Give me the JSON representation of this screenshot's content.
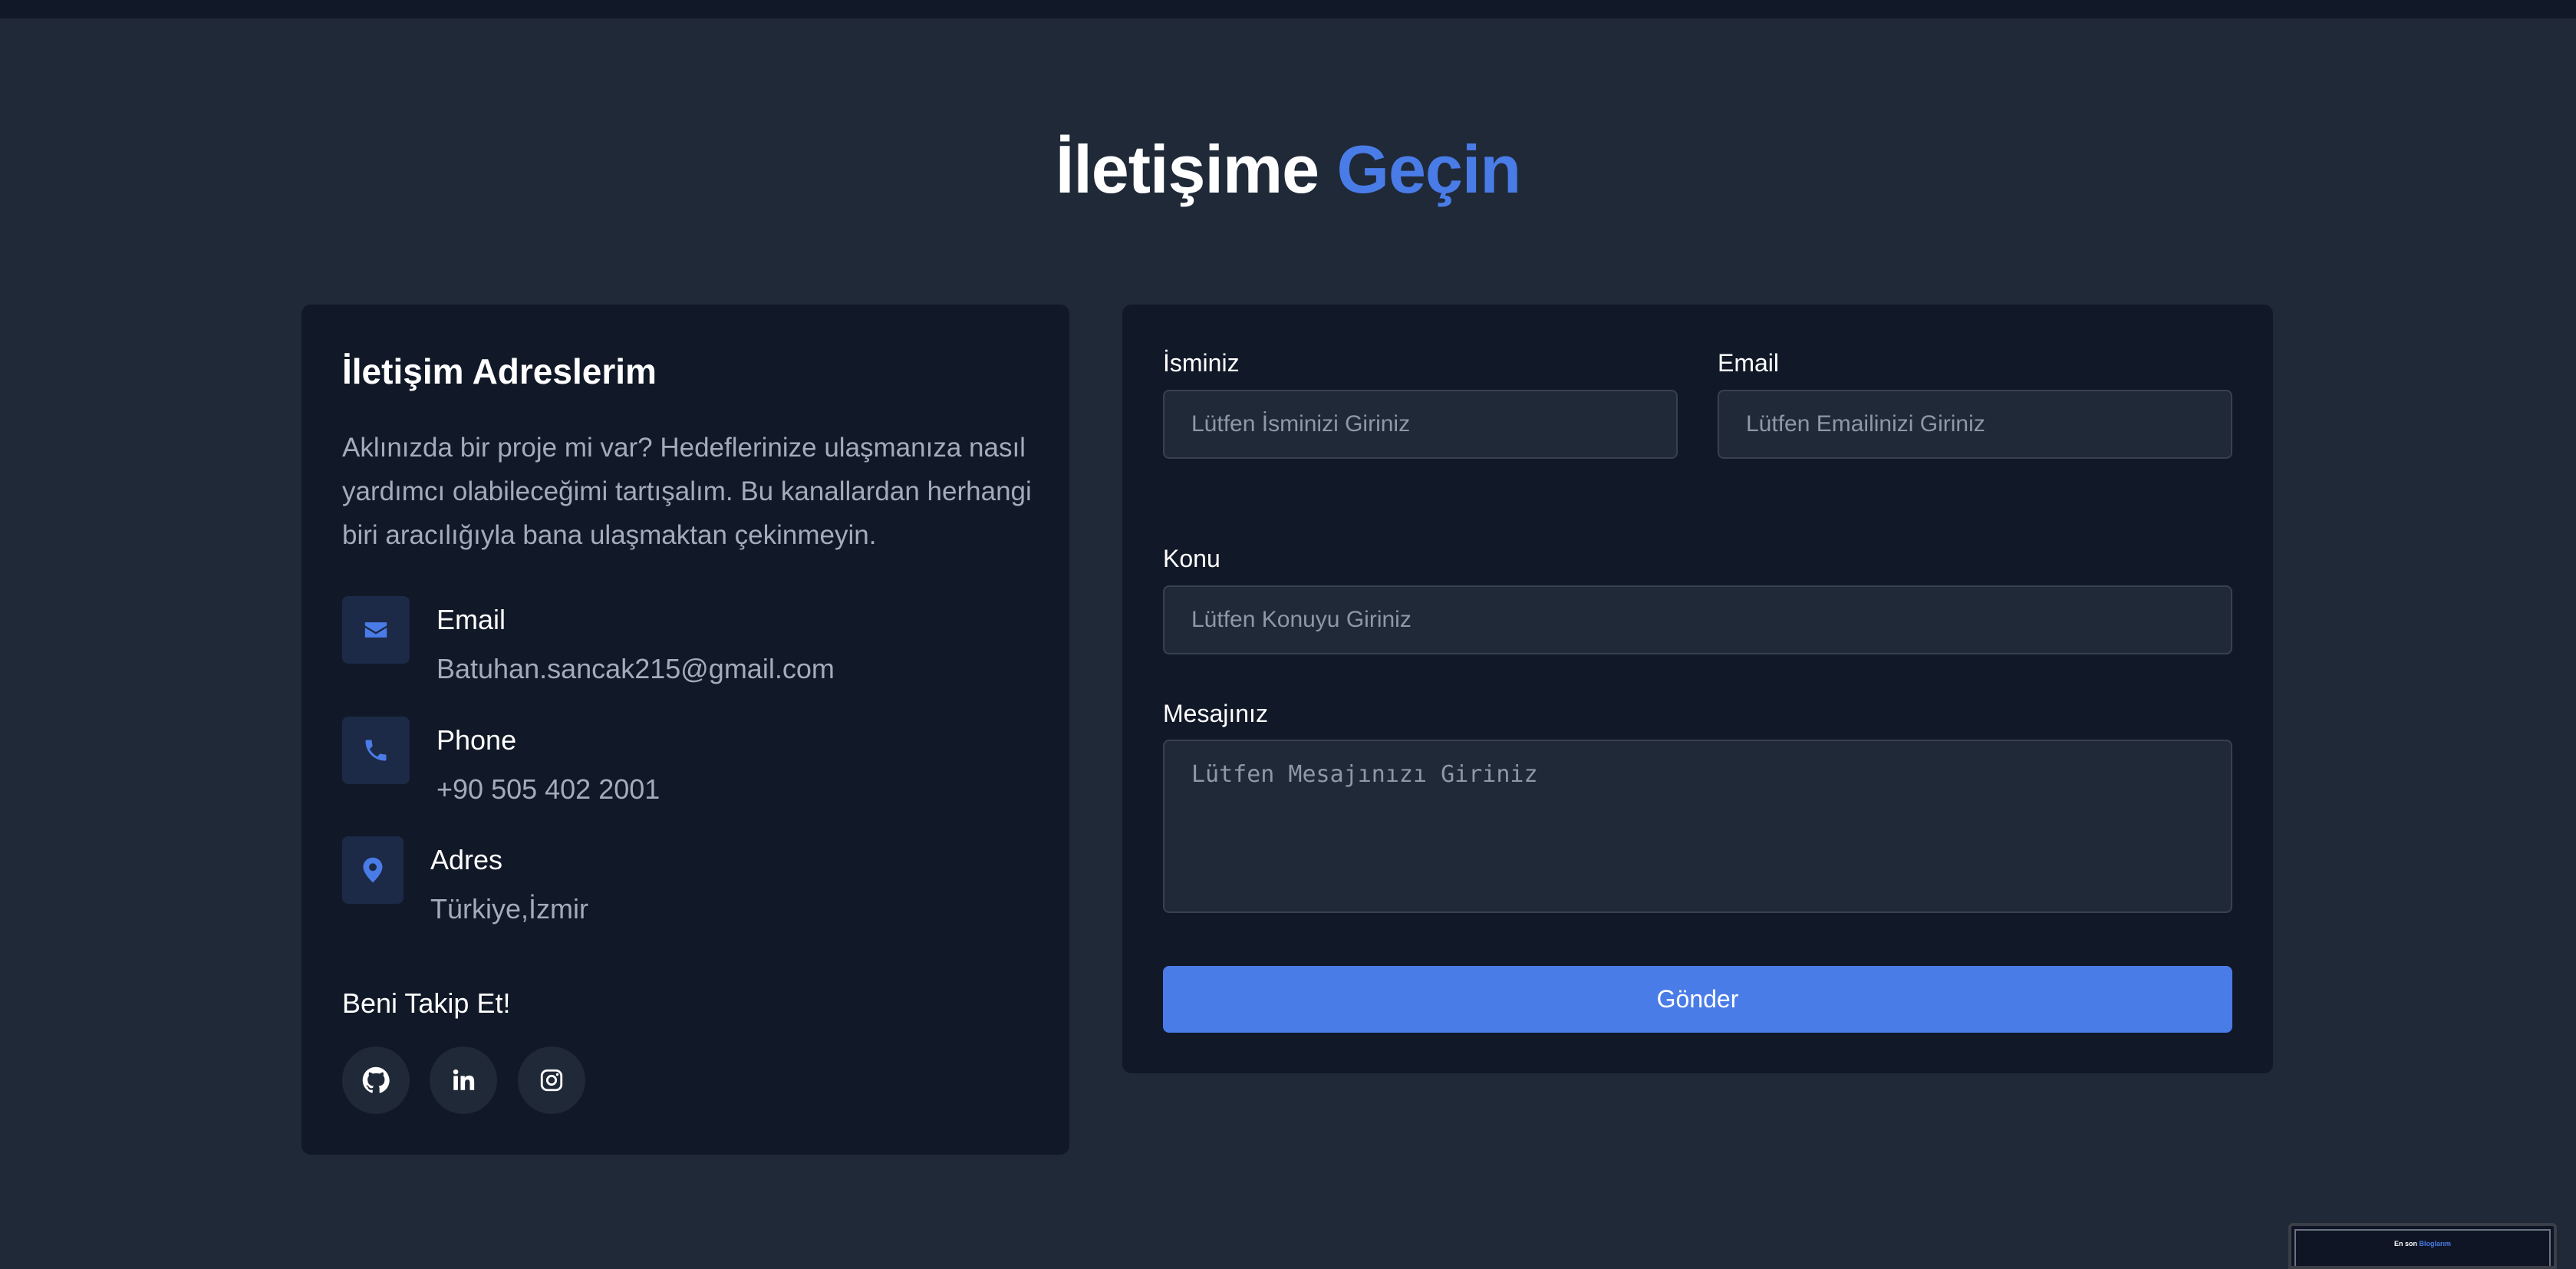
{
  "header": {
    "title_main": "İletişime",
    "title_accent": "Geçin"
  },
  "contact_card": {
    "heading": "İletişim Adreslerim",
    "intro": "Aklınızda bir proje mi var? Hedeflerinize ulaşmanıza nasıl yardımcı olabileceğimi tartışalım. Bu kanallardan herhangi biri aracılığıyla bana ulaşmaktan çekinmeyin.",
    "items": [
      {
        "label": "Email",
        "value": "Batuhan.sancak215@gmail.com",
        "icon": "envelope-icon"
      },
      {
        "label": "Phone",
        "value": "+90 505 402 2001",
        "icon": "phone-icon"
      },
      {
        "label": "Adres",
        "value": "Türkiye,İzmir",
        "icon": "map-pin-icon"
      }
    ],
    "follow_heading": "Beni Takip Et!",
    "socials": [
      "github-icon",
      "linkedin-icon",
      "instagram-icon"
    ]
  },
  "form": {
    "name_label": "İsminiz",
    "name_placeholder": "Lütfen İsminizi Giriniz",
    "email_label": "Email",
    "email_placeholder": "Lütfen Emailinizi Giriniz",
    "subject_label": "Konu",
    "subject_placeholder": "Lütfen Konuyu Giriniz",
    "message_label": "Mesajınız",
    "message_placeholder": "Lütfen Mesajınızı Giriniz",
    "submit_label": "Gönder"
  },
  "mini_preview": {
    "text_main": "En son",
    "text_accent": "Bloglarım"
  },
  "colors": {
    "background": "#1f2937",
    "card": "#111827",
    "accent": "#4a7ce8",
    "muted_text": "#a3acba"
  }
}
